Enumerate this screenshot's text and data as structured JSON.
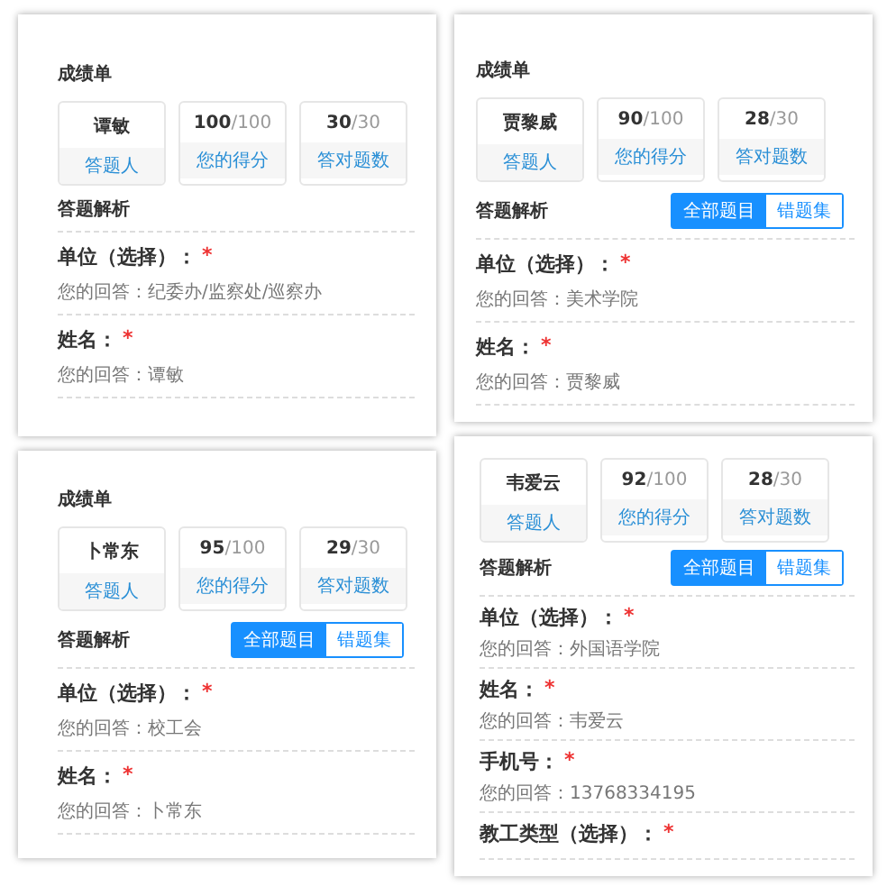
{
  "panels": [
    {
      "title": "成绩单",
      "stats": [
        {
          "value": "谭敏",
          "label": "答题人"
        },
        {
          "value": "100",
          "total": "/100",
          "label": "您的得分"
        },
        {
          "value": "30",
          "total": "/30",
          "label": "答对题数"
        }
      ],
      "section_title": "答题解析",
      "questions": [
        {
          "label": "单位（选择）：",
          "mark": "*",
          "answer": "您的回答：纪委办/监察处/巡察办"
        },
        {
          "label": "姓名：",
          "mark": "*",
          "answer": "您的回答：谭敏"
        }
      ]
    },
    {
      "title": "成绩单",
      "stats": [
        {
          "value": "贾黎威",
          "label": "答题人"
        },
        {
          "value": "90",
          "total": "/100",
          "label": "您的得分"
        },
        {
          "value": "28",
          "total": "/30",
          "label": "答对题数"
        }
      ],
      "section_title": "答题解析",
      "filter_tabs": [
        {
          "label": "全部题目",
          "selected": true
        },
        {
          "label": "错题集",
          "selected": false
        }
      ],
      "questions": [
        {
          "label": "单位（选择）：",
          "mark": "*",
          "answer": "您的回答：美术学院"
        },
        {
          "label": "姓名：",
          "mark": "*",
          "answer": "您的回答：贾黎威"
        }
      ]
    },
    {
      "title": "成绩单",
      "stats": [
        {
          "value": "卜常东",
          "label": "答题人"
        },
        {
          "value": "95",
          "total": "/100",
          "label": "您的得分"
        },
        {
          "value": "29",
          "total": "/30",
          "label": "答对题数"
        }
      ],
      "section_title": "答题解析",
      "filter_tabs": [
        {
          "label": "全部题目",
          "selected": true
        },
        {
          "label": "错题集",
          "selected": false
        }
      ],
      "questions": [
        {
          "label": "单位（选择）：",
          "mark": "*",
          "answer": "您的回答：校工会"
        },
        {
          "label": "姓名：",
          "mark": "*",
          "answer": "您的回答：卜常东"
        }
      ]
    },
    {
      "stats": [
        {
          "value": "韦爱云",
          "label": "答题人"
        },
        {
          "value": "92",
          "total": "/100",
          "label": "您的得分"
        },
        {
          "value": "28",
          "total": "/30",
          "label": "答对题数"
        }
      ],
      "section_title": "答题解析",
      "filter_tabs": [
        {
          "label": "全部题目",
          "selected": true
        },
        {
          "label": "错题集",
          "selected": false
        }
      ],
      "questions": [
        {
          "label": "单位（选择）：",
          "mark": "*",
          "answer": "您的回答：外国语学院"
        },
        {
          "label": "姓名：",
          "mark": "*",
          "answer": "您的回答：韦爱云"
        },
        {
          "label": "手机号：",
          "mark": "*",
          "answer": "您的回答：13768334195"
        },
        {
          "label": "教工类型（选择）：",
          "mark": "*"
        }
      ]
    }
  ]
}
